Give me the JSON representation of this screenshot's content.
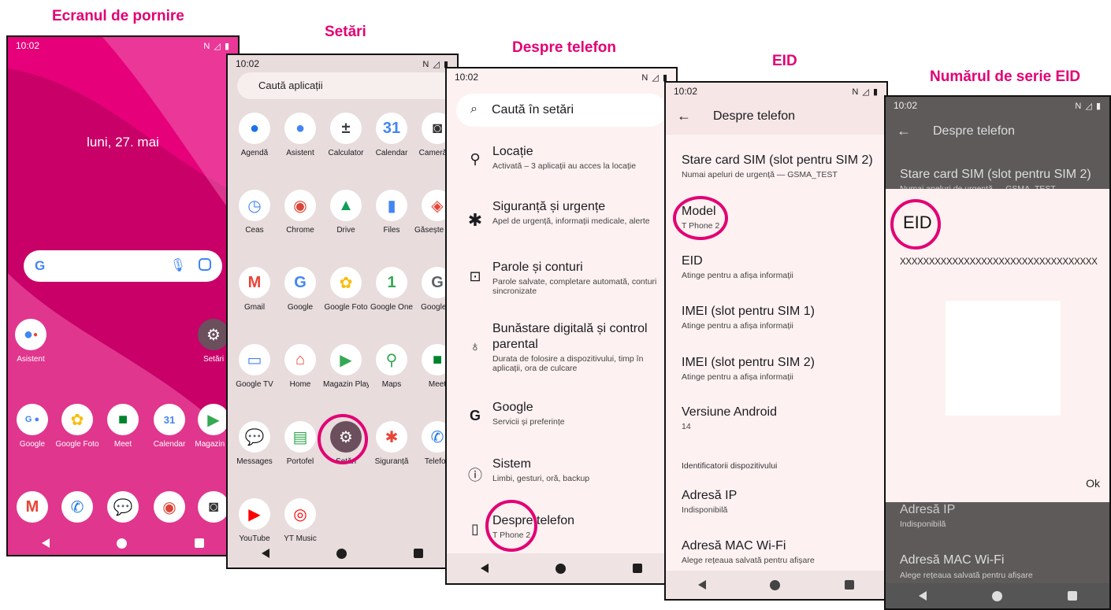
{
  "captions": {
    "home": "Ecranul de pornire",
    "settings": "Setări",
    "about": "Despre telefon",
    "eid": "EID",
    "eid_serial": "Numărul de serie EID"
  },
  "status": {
    "time": "10:02",
    "icons": "N ◿ ▮"
  },
  "home": {
    "date": "luni, 27. mai",
    "search_logo": "G",
    "apps_row1": [
      {
        "label": "Asistent",
        "icon": "assistant-icon"
      },
      {
        "label": "Setări",
        "icon": "settings-gear-icon"
      }
    ],
    "apps_row2": [
      {
        "label": "Google",
        "icon": "google-folder-icon"
      },
      {
        "label": "Google Foto",
        "icon": "google-photos-icon"
      },
      {
        "label": "Meet",
        "icon": "meet-icon"
      },
      {
        "label": "Calendar",
        "icon": "calendar-icon"
      },
      {
        "label": "Magazin P",
        "icon": "play-store-icon"
      }
    ],
    "dock": [
      {
        "label": "Gmail",
        "icon": "gmail-icon"
      },
      {
        "label": "Telefon",
        "icon": "phone-icon"
      },
      {
        "label": "Messages",
        "icon": "messages-icon"
      },
      {
        "label": "Chrome",
        "icon": "chrome-icon"
      },
      {
        "label": "Cameră",
        "icon": "camera-icon"
      }
    ]
  },
  "drawer": {
    "search_placeholder": "Caută aplicații",
    "apps": [
      "Agendă",
      "Asistent",
      "Calculator",
      "Calendar",
      "Cameră fo",
      "Ceas",
      "Chrome",
      "Drive",
      "Files",
      "Găsește dispozitiv",
      "Gmail",
      "Google",
      "Google Foto",
      "Google One",
      "Google P",
      "Google TV",
      "Home",
      "Magazin Play",
      "Maps",
      "Meet",
      "Messages",
      "Portofel",
      "Setări",
      "Siguranță",
      "Telefon",
      "YouTube",
      "YT Music"
    ]
  },
  "settings": {
    "search_placeholder": "Caută în setări",
    "items": [
      {
        "title": "Locație",
        "sub": "Activată – 3 aplicații au acces la locație",
        "icon": "location-icon"
      },
      {
        "title": "Siguranță și urgențe",
        "sub": "Apel de urgență, informații medicale, alerte",
        "icon": "asterisk-icon"
      },
      {
        "title": "Parole și conturi",
        "sub": "Parole salvate, completare automată, conturi sincronizate",
        "icon": "account-box-icon"
      },
      {
        "title": "Bunăstare digitală și control parental",
        "sub": "Durata de folosire a dispozitivului, timp în aplicații, ora de culcare",
        "icon": "wellbeing-icon"
      },
      {
        "title": "Google",
        "sub": "Servicii și preferințe",
        "icon": "google-g-icon"
      },
      {
        "title": "Sistem",
        "sub": "Limbi, gesturi, oră, backup",
        "icon": "info-icon"
      },
      {
        "title": "Despre telefon",
        "sub": "T Phone 2",
        "icon": "phone-device-icon"
      }
    ]
  },
  "about": {
    "header": "Despre telefon",
    "items": [
      {
        "title": "Stare card SIM (slot pentru SIM 2)",
        "sub": "Numai apeluri de urgență — GSMA_TEST"
      },
      {
        "title": "Model",
        "sub": "T Phone 2"
      },
      {
        "title": "EID",
        "sub": "Atinge pentru a afișa informații"
      },
      {
        "title": "IMEI (slot pentru SIM 1)",
        "sub": "Atinge pentru a afișa informații"
      },
      {
        "title": "IMEI (slot pentru SIM 2)",
        "sub": "Atinge pentru a afișa informații"
      },
      {
        "title": "Versiune Android",
        "sub": "14"
      }
    ],
    "section": "Identificatorii dispozitivului",
    "items2": [
      {
        "title": "Adresă IP",
        "sub": "Indisponibilă"
      },
      {
        "title": "Adresă MAC Wi-Fi",
        "sub": "Alege rețeaua salvată pentru afișare"
      }
    ]
  },
  "eid_dialog": {
    "bg_header": "Despre telefon",
    "bg_item_title": "Stare card SIM (slot pentru SIM 2)",
    "bg_item_sub": "Numai apeluri de urgență — GSMA_TEST",
    "title": "EID",
    "value": "XXXXXXXXXXXXXXXXXXXXXXXXXXXXXXXXXX",
    "ok": "Ok",
    "bg_ip_title": "Adresă IP",
    "bg_ip_sub": "Indisponibilă",
    "bg_mac_title": "Adresă MAC Wi-Fi",
    "bg_mac_sub": "Alege rețeaua salvată pentru afișare"
  },
  "colors": {
    "accent": "#e20074",
    "settings_bg": "#fdf1f1",
    "drawer_bg": "#e8dcdc"
  }
}
